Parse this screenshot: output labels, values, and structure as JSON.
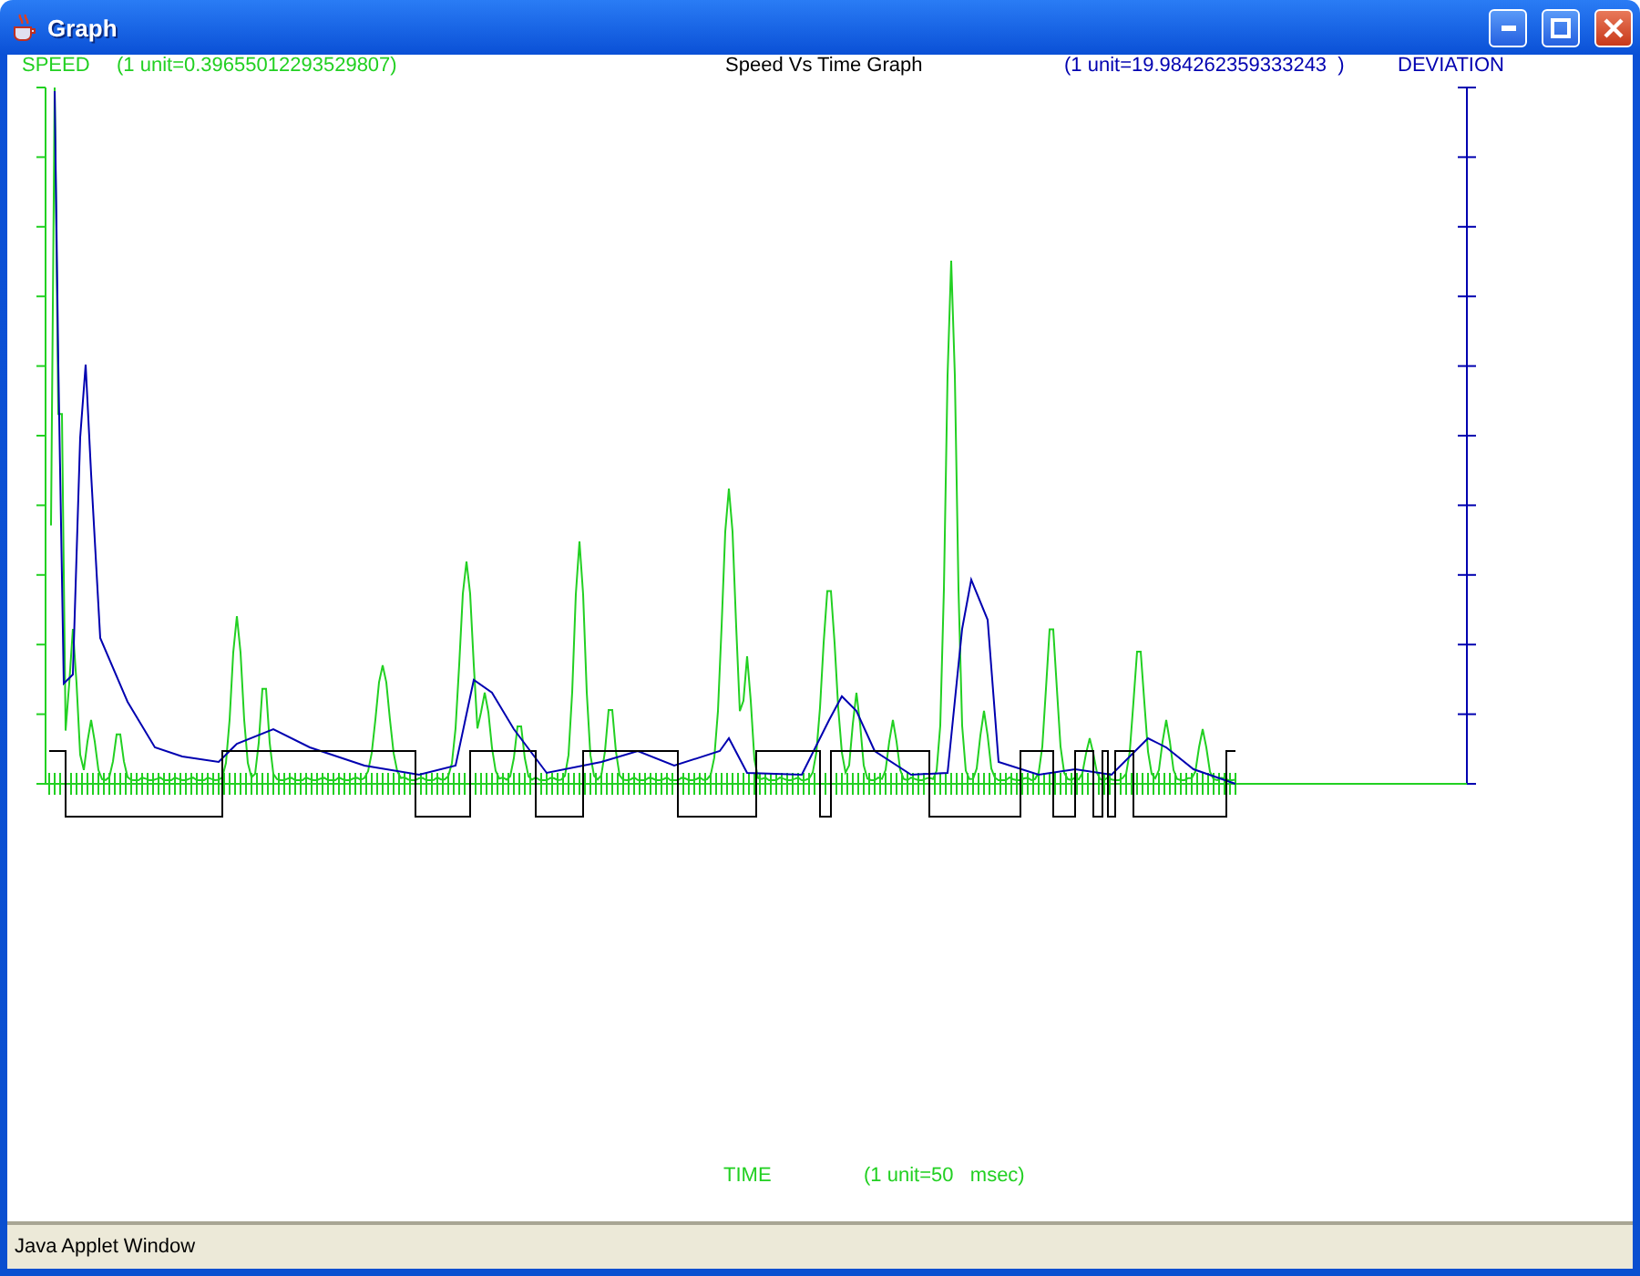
{
  "window": {
    "title": "Graph"
  },
  "graph": {
    "speed_label": "SPEED",
    "speed_unit": "(1 unit=0.39655012293529807)",
    "title": "Speed Vs Time Graph",
    "deviation_unit": "(1 unit=19.984262359333243  )",
    "deviation_label": "DEVIATION",
    "time_label": "TIME",
    "time_unit": "(1 unit=50   msec)"
  },
  "status_bar": {
    "text": "Java Applet Window"
  }
}
